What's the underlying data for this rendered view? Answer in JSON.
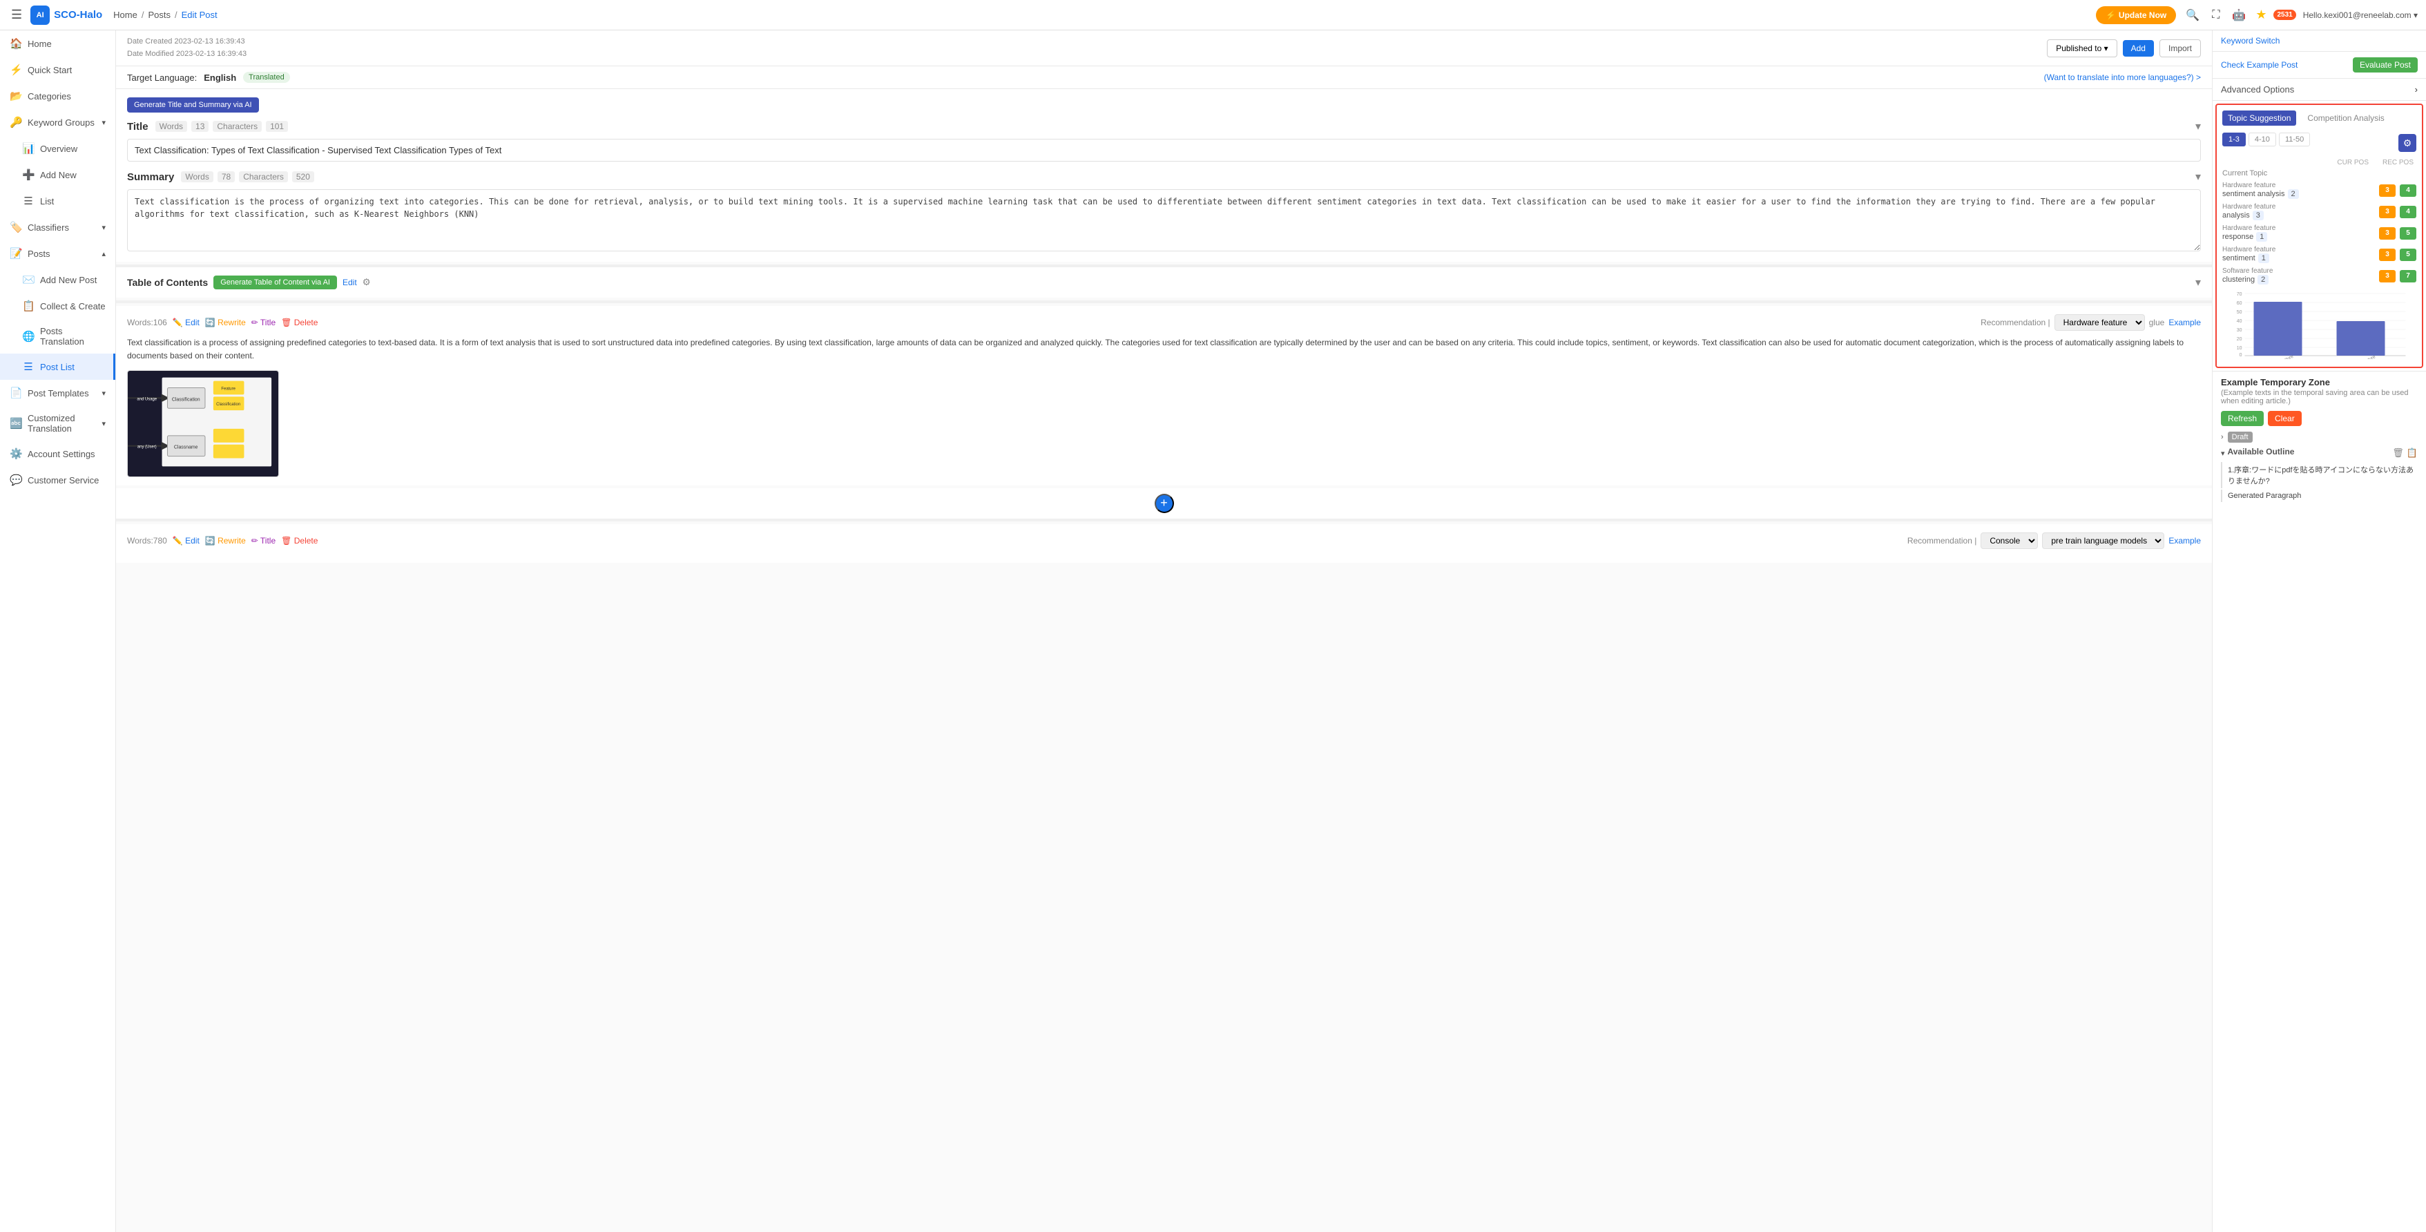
{
  "topbar": {
    "logo_text": "SCO-Halo",
    "hamburger_label": "☰",
    "breadcrumb": [
      "Home",
      "Posts",
      "Edit Post"
    ],
    "update_btn": "Update Now",
    "user_badge": "2531",
    "user_email": "Hello.kexi001@reneelab.com ▾",
    "star": "★"
  },
  "sidebar": {
    "items": [
      {
        "label": "Home",
        "icon": "🏠",
        "active": false
      },
      {
        "label": "Quick Start",
        "icon": "⚡",
        "active": false
      },
      {
        "label": "Categories",
        "icon": "📂",
        "active": false
      },
      {
        "label": "Keyword Groups",
        "icon": "🔑",
        "active": false,
        "has_chevron": true
      },
      {
        "label": "Overview",
        "icon": "📊",
        "active": false,
        "sub": true
      },
      {
        "label": "Add New",
        "icon": "➕",
        "active": false,
        "sub": true
      },
      {
        "label": "List",
        "icon": "☰",
        "active": false,
        "sub": true
      },
      {
        "label": "Classifiers",
        "icon": "🏷️",
        "active": false,
        "has_chevron": true
      },
      {
        "label": "Posts",
        "icon": "📝",
        "active": false,
        "has_chevron": true
      },
      {
        "label": "Add New Post",
        "icon": "✉️",
        "active": false,
        "sub": true
      },
      {
        "label": "Collect & Create",
        "icon": "📋",
        "active": false,
        "sub": true
      },
      {
        "label": "Posts Translation",
        "icon": "🌐",
        "active": false,
        "sub": true
      },
      {
        "label": "Post List",
        "icon": "☰",
        "active": true,
        "sub": true
      },
      {
        "label": "Post Templates",
        "icon": "📄",
        "active": false,
        "has_chevron": true
      },
      {
        "label": "Customized Translation",
        "icon": "🔤",
        "active": false,
        "has_chevron": true
      },
      {
        "label": "Account Settings",
        "icon": "⚙️",
        "active": false
      },
      {
        "label": "Customer Service",
        "icon": "💬",
        "active": false
      }
    ]
  },
  "content": {
    "date_created": "Date Created 2023-02-13 16:39:43",
    "date_modified": "Date Modified 2023-02-13 16:39:43",
    "publish_label": "Published to ▾",
    "add_btn": "Add",
    "import_btn": "Import",
    "target_language_label": "Target Language:",
    "target_language_value": "English",
    "translated_badge": "Translated",
    "translate_more": "(Want to translate into more languages?) >",
    "ai_title_btn": "Generate Title and Summary via AI",
    "title_section": "Title",
    "title_words_label": "Words",
    "title_words_value": "13",
    "title_chars_label": "Characters",
    "title_chars_value": "101",
    "title_value": "Text Classification: Types of Text Classification - Supervised Text Classification Types of Text",
    "summary_section": "Summary",
    "summary_words_label": "Words",
    "summary_words_value": "78",
    "summary_chars_label": "Characters",
    "summary_chars_value": "520",
    "summary_value": "Text classification is the process of organizing text into categories. This can be done for retrieval, analysis, or to build text mining tools. It is a supervised machine learning task that can be used to differentiate between different sentiment categories in text data. Text classification can be used to make it easier for a user to find the information they are trying to find. There are a few popular algorithms for text classification, such as K-Nearest Neighbors (KNN)",
    "toc_section": "Table of Contents",
    "toc_gen_btn": "Generate Table of Content via AI",
    "toc_edit_btn": "Edit",
    "block1": {
      "words": "Words:106",
      "edit": "Edit",
      "rewrite": "Rewrite",
      "title": "Title",
      "delete": "Delete",
      "recommendation_label": "Recommendation |",
      "recommendation_value": "Hardware feature",
      "glue": "glue",
      "example": "Example",
      "content": "Text classification is a process of assigning predefined categories to text-based data. It is a form of text analysis that is used to sort unstructured data into predefined categories. By using text classification, large amounts of data can be organized and analyzed quickly. The categories used for text classification are typically determined by the user and can be based on any criteria. This could include topics, sentiment, or keywords. Text classification can also be used for automatic document categorization, which is the process of automatically assigning labels to documents based on their content."
    },
    "block2": {
      "words": "Words:780",
      "edit": "Edit",
      "rewrite": "Rewrite",
      "title": "Title",
      "delete": "Delete",
      "recommendation_label": "Recommendation |",
      "recommendation_value": "Console",
      "extra_value": "pre train language models",
      "example": "Example"
    },
    "add_btn_label": "+"
  },
  "right_panel": {
    "keyword_switch": "Keyword Switch",
    "check_example": "Check Example Post",
    "evaluate": "Evaluate Post",
    "advanced_options": "Advanced Options",
    "topic_suggestion_tab": "Topic Suggestion",
    "competition_analysis_tab": "Competition Analysis",
    "range_1_3": "1-3",
    "range_4_10": "4-10",
    "range_11_50": "11-50",
    "cur_pos_label": "CUR POS",
    "rec_pos_label": "REC POS",
    "current_topic_label": "Current Topic",
    "topics": [
      {
        "category": "Hardware feature",
        "keyword": "sentiment analysis",
        "cur": "2",
        "pos_cur": "3",
        "pos_rec": "4"
      },
      {
        "category": "Hardware feature",
        "keyword": "analysis",
        "cur": "3",
        "pos_cur": "3",
        "pos_rec": "4"
      },
      {
        "category": "Hardware feature",
        "keyword": "response",
        "cur": "1",
        "pos_cur": "3",
        "pos_rec": "5"
      },
      {
        "category": "Hardware feature",
        "keyword": "sentiment",
        "cur": "1",
        "pos_cur": "3",
        "pos_rec": "5"
      },
      {
        "category": "Software feature",
        "keyword": "clustering",
        "cur": "2",
        "pos_cur": "3",
        "pos_rec": "7"
      }
    ],
    "chart_bars": [
      {
        "label": "Hardware feature",
        "value": 55
      },
      {
        "label": "Software feature",
        "value": 35
      }
    ],
    "chart_max": 70,
    "chart_ticks": [
      "70",
      "60",
      "50",
      "40",
      "30",
      "20",
      "10",
      "0"
    ],
    "example_zone_title": "Example Temporary Zone",
    "example_zone_sub": "(Example texts in the temporal saving area can be used when editing article.)",
    "refresh_btn": "Refresh",
    "clear_btn": "Clear",
    "draft_label": "Draft",
    "available_outline_label": "Available Outline",
    "outline_items": [
      "1.序章:ワードにpdfを貼る時アイコンにならない方法ありませんか?",
      "Generated Paragraph"
    ]
  }
}
